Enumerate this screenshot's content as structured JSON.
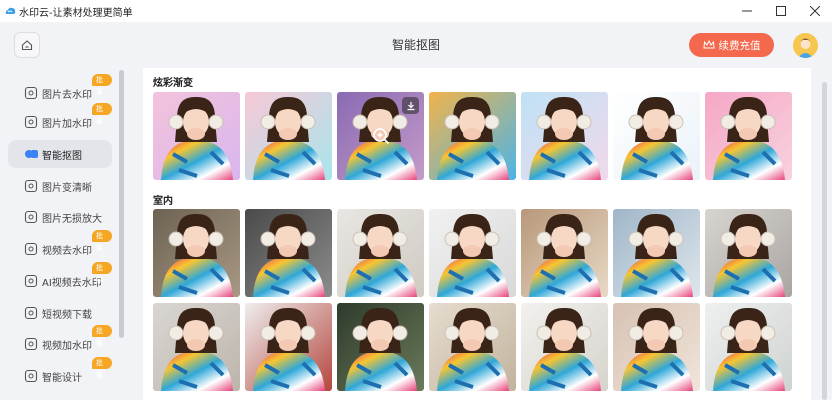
{
  "window": {
    "title": "水印云-让素材处理更简单",
    "controls": [
      "minimize-icon",
      "maximize-icon",
      "close-icon"
    ]
  },
  "header": {
    "title": "智能抠图",
    "vip_label": "续费充值",
    "home_icon": "home-icon"
  },
  "sidebar": {
    "items": [
      {
        "label": "图片去水印",
        "icon": "eraser-icon",
        "badge": "批量",
        "active": false
      },
      {
        "label": "图片加水印",
        "icon": "image-add-icon",
        "badge": "批量",
        "active": false
      },
      {
        "label": "智能抠图",
        "icon": "cutout-icon",
        "badge": "",
        "active": true
      },
      {
        "label": "图片变清晰",
        "icon": "hd-icon",
        "badge": "",
        "active": false
      },
      {
        "label": "图片无损放大",
        "icon": "enlarge-icon",
        "badge": "",
        "active": false
      },
      {
        "label": "视频去水印",
        "icon": "video-eraser-icon",
        "badge": "批量",
        "active": false
      },
      {
        "label": "AI视频去水印",
        "icon": "ai-icon",
        "badge": "批量",
        "active": false
      },
      {
        "label": "短视频下载",
        "icon": "download-icon",
        "badge": "",
        "active": false
      },
      {
        "label": "视频加水印",
        "icon": "video-add-icon",
        "badge": "批量",
        "active": false
      },
      {
        "label": "智能设计",
        "icon": "design-icon",
        "badge": "批量",
        "active": false
      }
    ]
  },
  "sections": [
    {
      "title": "炫彩渐变",
      "backgrounds": [
        [
          "#f3c3dc",
          "#d9b6ee"
        ],
        [
          "#f7c8d6",
          "#a8e5ec"
        ],
        [
          "#8a6ab3",
          "#c49bc9"
        ],
        [
          "#f2b34a",
          "#4bb5e8"
        ],
        [
          "#bfe1f5",
          "#f0d9ea"
        ],
        [
          "#ffffff",
          "#eaf2f8"
        ],
        [
          "#f5a7c6",
          "#f8d1de"
        ]
      ]
    },
    {
      "title": "室内",
      "backgrounds": [
        [
          "#6d6252",
          "#a89984"
        ],
        [
          "#4a4a4a",
          "#8c8c8c"
        ],
        [
          "#e9e7e3",
          "#cfcac2"
        ],
        [
          "#f1f1f1",
          "#d8d8d8"
        ],
        [
          "#b8987a",
          "#e8d9c6"
        ],
        [
          "#9fb6c9",
          "#dfe6ec"
        ],
        [
          "#d8d4d0",
          "#a9a5a2"
        ],
        [
          "#d9d6d2",
          "#bdb5ac"
        ],
        [
          "#eeeeee",
          "#b5463d"
        ],
        [
          "#2e3b2c",
          "#6a7a5a"
        ],
        [
          "#e6ddd0",
          "#c2b39d"
        ],
        [
          "#f2f1ee",
          "#d6d3cc"
        ],
        [
          "#d7c2b3",
          "#f0e4da"
        ],
        [
          "#eef0ef",
          "#cfd3d0"
        ]
      ]
    }
  ],
  "colors": {
    "accent": "#f4684d",
    "badge": "#f5a623",
    "active_icon": "#3b82f6"
  }
}
